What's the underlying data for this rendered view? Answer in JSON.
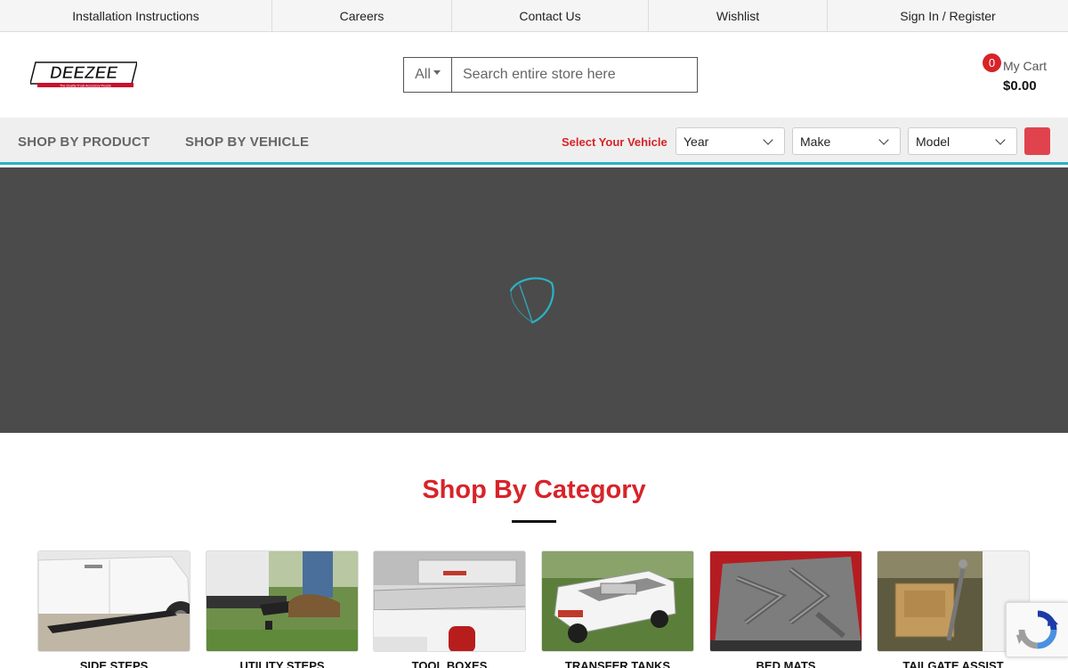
{
  "topbar": {
    "links": [
      {
        "label": "Installation Instructions"
      },
      {
        "label": "Careers"
      },
      {
        "label": "Contact Us"
      },
      {
        "label": "Wishlist"
      },
      {
        "label": "Sign In / Register"
      }
    ]
  },
  "header": {
    "logo_text": "DEEZEE",
    "logo_tagline": "The Quality Truck Accessory People",
    "search": {
      "category": "All",
      "placeholder": "Search entire store here"
    },
    "cart": {
      "count": "0",
      "label": "My Cart",
      "total": "$0.00"
    }
  },
  "nav": {
    "shop_by_product": "SHOP BY PRODUCT",
    "shop_by_vehicle": "SHOP BY VEHICLE",
    "vehicle_label": "Select Your Vehicle",
    "year": "Year",
    "make": "Make",
    "model": "Model"
  },
  "section": {
    "title": "Shop By Category"
  },
  "categories": [
    {
      "label": "SIDE STEPS"
    },
    {
      "label": "UTILITY STEPS"
    },
    {
      "label": "TOOL BOXES"
    },
    {
      "label": "TRANSFER TANKS"
    },
    {
      "label": "BED MATS"
    },
    {
      "label": "TAILGATE ASSIST"
    }
  ],
  "colors": {
    "brand_red": "#d8232a",
    "accent_teal": "#2ab3c4",
    "hero_bg": "#4b4b4b"
  }
}
